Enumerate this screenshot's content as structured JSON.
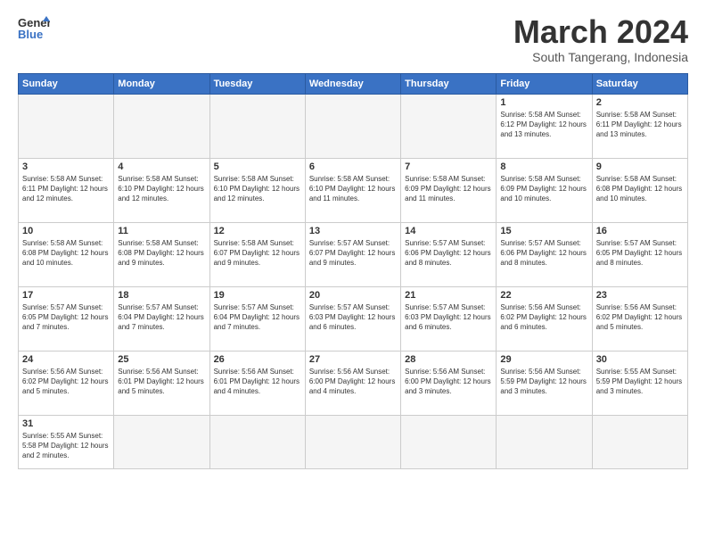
{
  "header": {
    "logo_line1": "General",
    "logo_line2": "Blue",
    "month_title": "March 2024",
    "subtitle": "South Tangerang, Indonesia"
  },
  "days_of_week": [
    "Sunday",
    "Monday",
    "Tuesday",
    "Wednesday",
    "Thursday",
    "Friday",
    "Saturday"
  ],
  "weeks": [
    [
      {
        "day": "",
        "info": ""
      },
      {
        "day": "",
        "info": ""
      },
      {
        "day": "",
        "info": ""
      },
      {
        "day": "",
        "info": ""
      },
      {
        "day": "",
        "info": ""
      },
      {
        "day": "1",
        "info": "Sunrise: 5:58 AM\nSunset: 6:12 PM\nDaylight: 12 hours and 13 minutes."
      },
      {
        "day": "2",
        "info": "Sunrise: 5:58 AM\nSunset: 6:11 PM\nDaylight: 12 hours and 13 minutes."
      }
    ],
    [
      {
        "day": "3",
        "info": "Sunrise: 5:58 AM\nSunset: 6:11 PM\nDaylight: 12 hours and 12 minutes."
      },
      {
        "day": "4",
        "info": "Sunrise: 5:58 AM\nSunset: 6:10 PM\nDaylight: 12 hours and 12 minutes."
      },
      {
        "day": "5",
        "info": "Sunrise: 5:58 AM\nSunset: 6:10 PM\nDaylight: 12 hours and 12 minutes."
      },
      {
        "day": "6",
        "info": "Sunrise: 5:58 AM\nSunset: 6:10 PM\nDaylight: 12 hours and 11 minutes."
      },
      {
        "day": "7",
        "info": "Sunrise: 5:58 AM\nSunset: 6:09 PM\nDaylight: 12 hours and 11 minutes."
      },
      {
        "day": "8",
        "info": "Sunrise: 5:58 AM\nSunset: 6:09 PM\nDaylight: 12 hours and 10 minutes."
      },
      {
        "day": "9",
        "info": "Sunrise: 5:58 AM\nSunset: 6:08 PM\nDaylight: 12 hours and 10 minutes."
      }
    ],
    [
      {
        "day": "10",
        "info": "Sunrise: 5:58 AM\nSunset: 6:08 PM\nDaylight: 12 hours and 10 minutes."
      },
      {
        "day": "11",
        "info": "Sunrise: 5:58 AM\nSunset: 6:08 PM\nDaylight: 12 hours and 9 minutes."
      },
      {
        "day": "12",
        "info": "Sunrise: 5:58 AM\nSunset: 6:07 PM\nDaylight: 12 hours and 9 minutes."
      },
      {
        "day": "13",
        "info": "Sunrise: 5:57 AM\nSunset: 6:07 PM\nDaylight: 12 hours and 9 minutes."
      },
      {
        "day": "14",
        "info": "Sunrise: 5:57 AM\nSunset: 6:06 PM\nDaylight: 12 hours and 8 minutes."
      },
      {
        "day": "15",
        "info": "Sunrise: 5:57 AM\nSunset: 6:06 PM\nDaylight: 12 hours and 8 minutes."
      },
      {
        "day": "16",
        "info": "Sunrise: 5:57 AM\nSunset: 6:05 PM\nDaylight: 12 hours and 8 minutes."
      }
    ],
    [
      {
        "day": "17",
        "info": "Sunrise: 5:57 AM\nSunset: 6:05 PM\nDaylight: 12 hours and 7 minutes."
      },
      {
        "day": "18",
        "info": "Sunrise: 5:57 AM\nSunset: 6:04 PM\nDaylight: 12 hours and 7 minutes."
      },
      {
        "day": "19",
        "info": "Sunrise: 5:57 AM\nSunset: 6:04 PM\nDaylight: 12 hours and 7 minutes."
      },
      {
        "day": "20",
        "info": "Sunrise: 5:57 AM\nSunset: 6:03 PM\nDaylight: 12 hours and 6 minutes."
      },
      {
        "day": "21",
        "info": "Sunrise: 5:57 AM\nSunset: 6:03 PM\nDaylight: 12 hours and 6 minutes."
      },
      {
        "day": "22",
        "info": "Sunrise: 5:56 AM\nSunset: 6:02 PM\nDaylight: 12 hours and 6 minutes."
      },
      {
        "day": "23",
        "info": "Sunrise: 5:56 AM\nSunset: 6:02 PM\nDaylight: 12 hours and 5 minutes."
      }
    ],
    [
      {
        "day": "24",
        "info": "Sunrise: 5:56 AM\nSunset: 6:02 PM\nDaylight: 12 hours and 5 minutes."
      },
      {
        "day": "25",
        "info": "Sunrise: 5:56 AM\nSunset: 6:01 PM\nDaylight: 12 hours and 5 minutes."
      },
      {
        "day": "26",
        "info": "Sunrise: 5:56 AM\nSunset: 6:01 PM\nDaylight: 12 hours and 4 minutes."
      },
      {
        "day": "27",
        "info": "Sunrise: 5:56 AM\nSunset: 6:00 PM\nDaylight: 12 hours and 4 minutes."
      },
      {
        "day": "28",
        "info": "Sunrise: 5:56 AM\nSunset: 6:00 PM\nDaylight: 12 hours and 3 minutes."
      },
      {
        "day": "29",
        "info": "Sunrise: 5:56 AM\nSunset: 5:59 PM\nDaylight: 12 hours and 3 minutes."
      },
      {
        "day": "30",
        "info": "Sunrise: 5:55 AM\nSunset: 5:59 PM\nDaylight: 12 hours and 3 minutes."
      }
    ],
    [
      {
        "day": "31",
        "info": "Sunrise: 5:55 AM\nSunset: 5:58 PM\nDaylight: 12 hours and 2 minutes."
      },
      {
        "day": "",
        "info": ""
      },
      {
        "day": "",
        "info": ""
      },
      {
        "day": "",
        "info": ""
      },
      {
        "day": "",
        "info": ""
      },
      {
        "day": "",
        "info": ""
      },
      {
        "day": "",
        "info": ""
      }
    ]
  ]
}
